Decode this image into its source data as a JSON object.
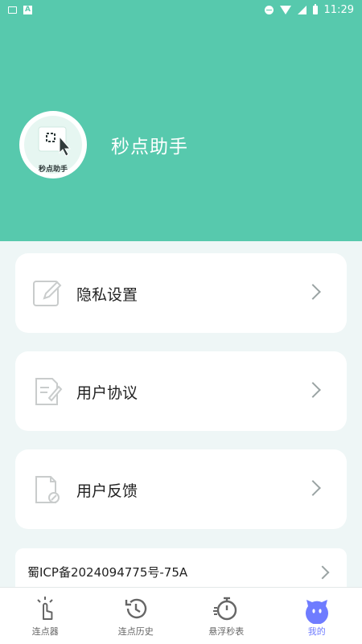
{
  "status_bar": {
    "time": "11:29",
    "left_icons": [
      "image-icon",
      "a-badge-icon"
    ],
    "right_icons": [
      "do-not-disturb-icon",
      "wifi-icon",
      "signal-icon",
      "battery-icon"
    ]
  },
  "profile": {
    "app_name": "秒点助手",
    "avatar_label": "秒点助手"
  },
  "menu": [
    {
      "id": "privacy",
      "label": "隐私设置",
      "icon": "edit-icon"
    },
    {
      "id": "agreement",
      "label": "用户协议",
      "icon": "document-edit-icon"
    },
    {
      "id": "feedback",
      "label": "用户反馈",
      "icon": "document-feedback-icon"
    }
  ],
  "icp": {
    "label": "蜀ICP备2024094775号-75A"
  },
  "tabbar": {
    "tabs": [
      {
        "id": "clicker",
        "label": "连点器",
        "icon": "tap-hand-icon"
      },
      {
        "id": "history",
        "label": "连点历史",
        "icon": "history-icon"
      },
      {
        "id": "stopwatch",
        "label": "悬浮秒表",
        "icon": "stopwatch-icon"
      },
      {
        "id": "mine",
        "label": "我的",
        "icon": "mascot-icon"
      }
    ],
    "active": "mine"
  },
  "colors": {
    "header": "#57c9ad",
    "background": "#eef6f6",
    "active_tab": "#6f7cff",
    "chevron": "#9aa3a3"
  }
}
